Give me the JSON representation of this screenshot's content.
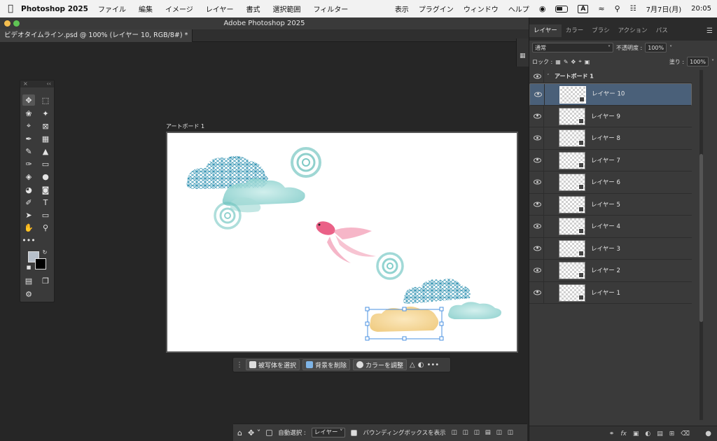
{
  "menubar": {
    "app": "Photoshop 2025",
    "items": [
      "ファイル",
      "編集",
      "イメージ",
      "レイヤー",
      "書式",
      "選択範囲",
      "フィルター"
    ],
    "right_items": [
      "表示",
      "プラグイン",
      "ウィンドウ",
      "ヘルプ"
    ],
    "input_mode": "A",
    "date": "7月7日(月)",
    "time": "20:05"
  },
  "window": {
    "title": "Adobe Photoshop 2025",
    "doc_tab": "ビデオタイムライン.psd @ 100% (レイヤー 10, RGB/8#) *"
  },
  "canvas": {
    "artboard_label": "アートボード 1"
  },
  "taskbar": {
    "select_subject": "被写体を選択",
    "remove_bg": "背景を削除",
    "adjust_color": "カラーを調整",
    "more": "•••"
  },
  "options": {
    "auto_select": "自動選択 :",
    "target": "レイヤー",
    "bounding_box": "バウンディングボックスを表示"
  },
  "panel": {
    "tabs": [
      "レイヤー",
      "カラー",
      "ブラシ",
      "アクション",
      "パス"
    ],
    "blend_mode": "通常",
    "opacity_label": "不透明度 :",
    "opacity": "100%",
    "lock_label": "ロック :",
    "fill_label": "塗り :",
    "fill": "100%",
    "group_name": "アートボード 1",
    "layers": [
      {
        "name": "レイヤー 10",
        "selected": true
      },
      {
        "name": "レイヤー 9",
        "selected": false
      },
      {
        "name": "レイヤー 8",
        "selected": false
      },
      {
        "name": "レイヤー 7",
        "selected": false
      },
      {
        "name": "レイヤー 6",
        "selected": false
      },
      {
        "name": "レイヤー 5",
        "selected": false
      },
      {
        "name": "レイヤー 4",
        "selected": false
      },
      {
        "name": "レイヤー 3",
        "selected": false
      },
      {
        "name": "レイヤー 2",
        "selected": false
      },
      {
        "name": "レイヤー 1",
        "selected": false
      }
    ],
    "footer_icons": [
      "link-icon",
      "fx-icon",
      "mask-icon",
      "adjustment-icon",
      "folder-icon",
      "new-layer-icon",
      "trash-icon"
    ]
  },
  "colors": {
    "selection": "#4a6079",
    "accent_pattern": "#2a8fb0",
    "accent_watercolor": "#8fd3d0",
    "cloud_yellow": "#f2d18c",
    "goldfish": "#e8507a"
  }
}
